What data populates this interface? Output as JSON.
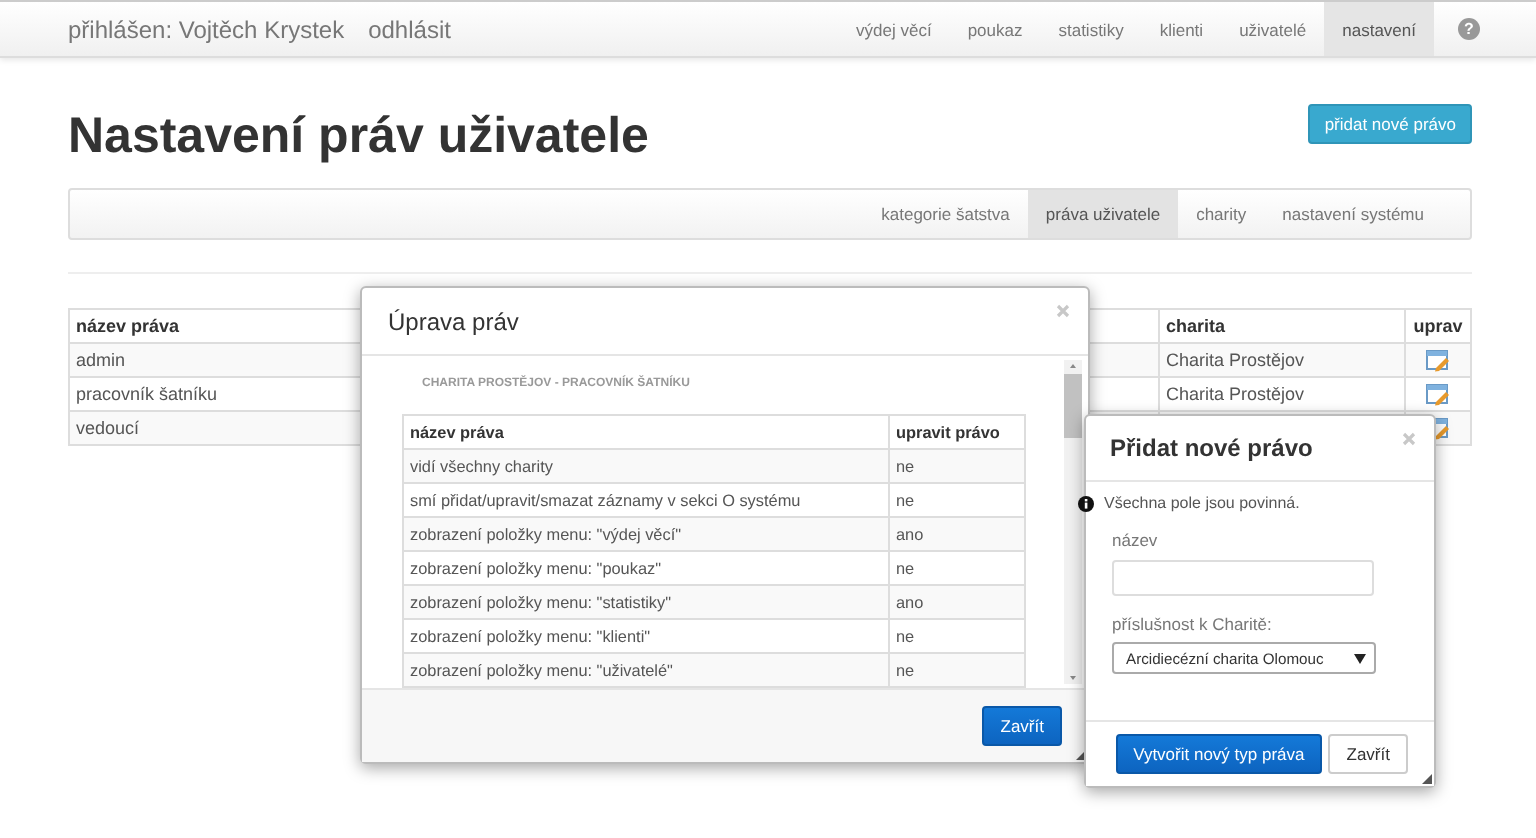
{
  "navbar": {
    "user_label": "přihlášen: Vojtěch Krystek",
    "logout": "odhlásit",
    "help": "?",
    "items": [
      {
        "label": "výdej věcí",
        "selected": false
      },
      {
        "label": "poukaz",
        "selected": false
      },
      {
        "label": "statistiky",
        "selected": false
      },
      {
        "label": "klienti",
        "selected": false
      },
      {
        "label": "uživatelé",
        "selected": false
      },
      {
        "label": "nastavení",
        "selected": true
      }
    ]
  },
  "page": {
    "title": "Nastavení práv uživatele",
    "add_button": "přidat nové právo"
  },
  "subnav": [
    {
      "label": "kategorie šatstva",
      "selected": false
    },
    {
      "label": "práva uživatele",
      "selected": true
    },
    {
      "label": "charity",
      "selected": false
    },
    {
      "label": "nastavení systému",
      "selected": false
    }
  ],
  "rights_table": {
    "columns": [
      "název práva",
      "charita",
      "uprav"
    ],
    "rows": [
      {
        "name": "admin",
        "charita": "Charita Prostějov"
      },
      {
        "name": "pracovník šatníku",
        "charita": "Charita Prostějov"
      },
      {
        "name": "vedoucí"
      }
    ]
  },
  "edit_dialog": {
    "title": "Úprava práv",
    "subtitle": "CHARITA PROSTĚJOV - PRACOVNÍK ŠATNÍKU",
    "columns": [
      "název práva",
      "upravit právo"
    ],
    "rows": [
      {
        "name": "vidí všechny charity",
        "value": "ne"
      },
      {
        "name": "smí přidat/upravit/smazat záznamy v sekci O systému",
        "value": "ne"
      },
      {
        "name": "zobrazení položky menu: \"výdej věcí\"",
        "value": "ano"
      },
      {
        "name": "zobrazení položky menu: \"poukaz\"",
        "value": "ne"
      },
      {
        "name": "zobrazení položky menu: \"statistiky\"",
        "value": "ano"
      },
      {
        "name": "zobrazení položky menu: \"klienti\"",
        "value": "ne"
      },
      {
        "name": "zobrazení položky menu: \"uživatelé\"",
        "value": "ne"
      }
    ],
    "close_button": "Zavřít"
  },
  "add_dialog": {
    "title": "Přidat nové právo",
    "note": "Všechna pole jsou povinná.",
    "name_label": "název",
    "charity_label": "příslušnost k Charitě:",
    "charity_value": "Arcidiecézní charita Olomouc",
    "submit_button": "Vytvořit nový typ práva",
    "close_button": "Zavřít"
  }
}
